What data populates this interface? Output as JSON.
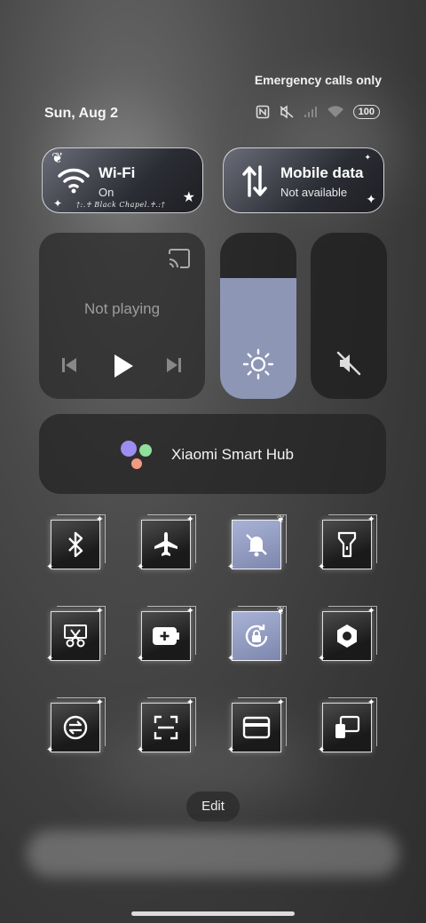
{
  "status_bar": {
    "carrier_text": "Emergency calls only",
    "date": "Sun, Aug 2",
    "battery": "100",
    "icons": [
      "nfc-icon",
      "mute-icon",
      "signal-icon",
      "wifi-icon"
    ]
  },
  "wifi_tile": {
    "title": "Wi-Fi",
    "status": "On",
    "banner": "†:.♰ Black Chapel.♰.:†"
  },
  "mobile_tile": {
    "title": "Mobile data",
    "status": "Not available"
  },
  "media": {
    "status": "Not playing"
  },
  "brightness": {
    "level": 0.73,
    "accent": "#8d96b4"
  },
  "volume": {
    "level": 0,
    "muted": true
  },
  "hub": {
    "label": "Xiaomi Smart Hub"
  },
  "toggles": [
    {
      "name": "bluetooth",
      "active": false
    },
    {
      "name": "airplane",
      "active": false
    },
    {
      "name": "dnd",
      "active": true
    },
    {
      "name": "flashlight",
      "active": false
    },
    {
      "name": "screenshot",
      "active": false
    },
    {
      "name": "battery-saver",
      "active": false
    },
    {
      "name": "rotation-lock",
      "active": true
    },
    {
      "name": "settings",
      "active": false
    },
    {
      "name": "sync",
      "active": false
    },
    {
      "name": "scanner",
      "active": false
    },
    {
      "name": "card",
      "active": false
    },
    {
      "name": "cast-devices",
      "active": false
    }
  ],
  "edit_label": "Edit"
}
